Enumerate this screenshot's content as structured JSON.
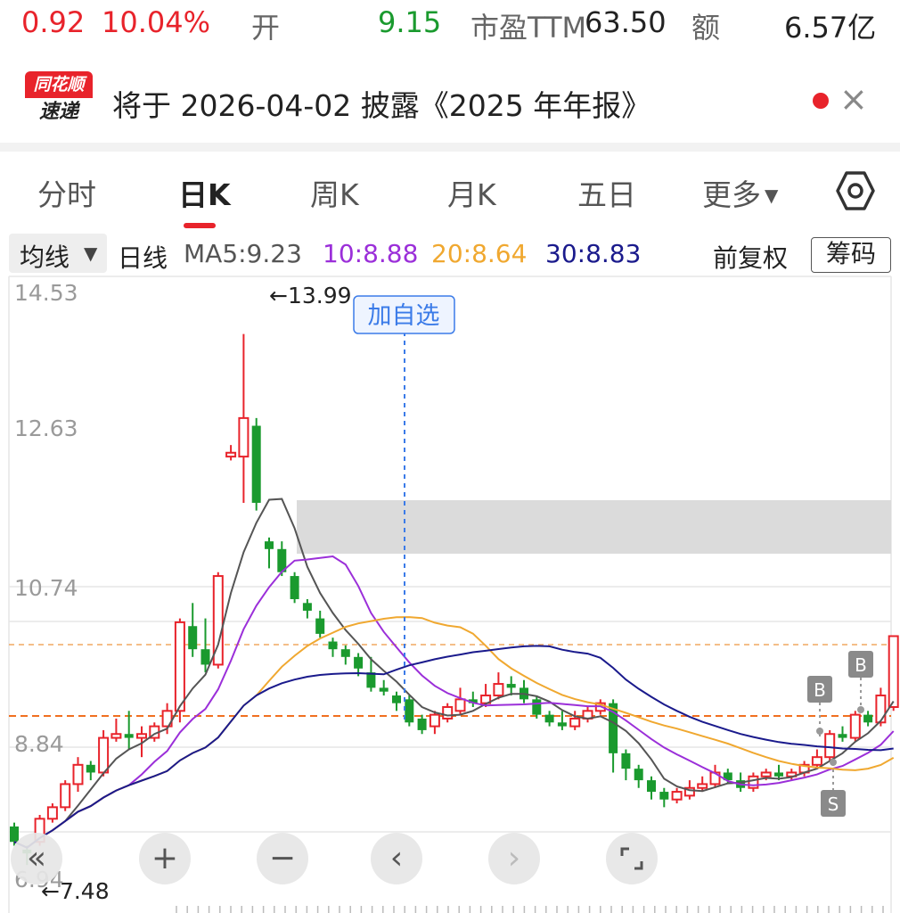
{
  "quote": {
    "change": "0.92",
    "change_pct": "10.04%",
    "open_label": "开",
    "open_value": "9.15",
    "pe_label": "市盈TTM",
    "pe_value": "63.50",
    "amount_label": "额",
    "amount_value": "6.57亿"
  },
  "notice": {
    "logo_top": "同花顺",
    "logo_bottom": "速递",
    "text": "将于 2026-04-02 披露《2025 年年报》"
  },
  "tabs": [
    "分时",
    "日K",
    "周K",
    "月K",
    "五日",
    "更多"
  ],
  "active_tab": "日K",
  "ma": {
    "selector": "均线",
    "period": "日线",
    "ma5": "MA5:9.23",
    "ma10": "10:8.88",
    "ma20": "20:8.64",
    "ma30": "30:8.83",
    "adjust": "前复权",
    "chips": "筹码"
  },
  "colors": {
    "up": "#e8232b",
    "down": "#1a9a2e",
    "ma5": "#555555",
    "ma10": "#9b2fd9",
    "ma20": "#f0a830",
    "ma30": "#1a1a8c",
    "crosshair": "#3b7be8"
  },
  "chart_data": {
    "type": "candlestick",
    "y_ticks": [
      "14.53",
      "12.63",
      "10.74",
      "8.84",
      "6.94"
    ],
    "ylim": [
      6.94,
      14.53
    ],
    "high_marker": "←13.99",
    "low_marker": "←7.48",
    "add_watch_label": "加自选",
    "signals": [
      "B",
      "B",
      "S"
    ],
    "candles": [
      [
        7.6,
        7.4,
        7.65,
        7.35
      ],
      [
        7.3,
        7.25,
        7.35,
        7.1
      ],
      [
        7.4,
        7.7,
        7.75,
        7.35
      ],
      [
        7.7,
        7.85,
        7.9,
        7.65
      ],
      [
        7.85,
        8.15,
        8.2,
        7.8
      ],
      [
        8.15,
        8.4,
        8.5,
        8.05
      ],
      [
        8.4,
        8.3,
        8.45,
        8.2
      ],
      [
        8.3,
        8.75,
        8.85,
        8.25
      ],
      [
        8.75,
        8.8,
        9.0,
        8.7
      ],
      [
        8.8,
        8.75,
        9.1,
        8.6
      ],
      [
        8.75,
        8.8,
        8.9,
        8.5
      ],
      [
        8.75,
        8.9,
        8.95,
        8.7
      ],
      [
        8.9,
        9.1,
        9.2,
        8.8
      ],
      [
        9.1,
        10.25,
        10.3,
        8.95
      ],
      [
        10.2,
        9.9,
        10.5,
        9.8
      ],
      [
        9.9,
        9.7,
        10.3,
        9.6
      ],
      [
        9.7,
        10.85,
        10.9,
        9.65
      ],
      [
        12.4,
        12.45,
        12.55,
        12.35
      ],
      [
        12.4,
        12.9,
        13.99,
        11.8
      ],
      [
        12.8,
        11.8,
        12.9,
        11.7
      ],
      [
        11.3,
        11.2,
        11.35,
        10.95
      ],
      [
        11.2,
        10.9,
        11.3,
        10.85
      ],
      [
        10.85,
        10.55,
        10.9,
        10.5
      ],
      [
        10.5,
        10.4,
        10.55,
        10.3
      ],
      [
        10.3,
        10.1,
        10.4,
        10.05
      ],
      [
        10.0,
        9.9,
        10.05,
        9.8
      ],
      [
        9.9,
        9.8,
        9.95,
        9.7
      ],
      [
        9.8,
        9.65,
        9.85,
        9.55
      ],
      [
        9.6,
        9.4,
        9.8,
        9.35
      ],
      [
        9.4,
        9.35,
        9.5,
        9.3
      ],
      [
        9.3,
        9.2,
        9.35,
        9.1
      ],
      [
        9.25,
        8.95,
        9.3,
        8.9
      ],
      [
        9.0,
        8.85,
        9.05,
        8.8
      ],
      [
        8.9,
        9.05,
        9.1,
        8.8
      ],
      [
        9.0,
        9.15,
        9.2,
        8.95
      ],
      [
        9.1,
        9.25,
        9.4,
        9.05
      ],
      [
        9.25,
        9.2,
        9.35,
        9.15
      ],
      [
        9.2,
        9.3,
        9.45,
        9.15
      ],
      [
        9.3,
        9.45,
        9.6,
        9.25
      ],
      [
        9.45,
        9.4,
        9.55,
        9.3
      ],
      [
        9.4,
        9.25,
        9.5,
        9.2
      ],
      [
        9.25,
        9.05,
        9.3,
        9.0
      ],
      [
        9.05,
        8.95,
        9.1,
        8.9
      ],
      [
        8.95,
        8.9,
        9.1,
        8.85
      ],
      [
        8.9,
        9.0,
        9.1,
        8.85
      ],
      [
        9.0,
        9.1,
        9.15,
        8.95
      ],
      [
        9.1,
        9.2,
        9.25,
        9.05
      ],
      [
        9.2,
        8.55,
        9.25,
        8.3
      ],
      [
        8.55,
        8.35,
        8.6,
        8.2
      ],
      [
        8.35,
        8.2,
        8.4,
        8.1
      ],
      [
        8.2,
        8.05,
        8.25,
        7.95
      ],
      [
        8.05,
        7.95,
        8.1,
        7.85
      ],
      [
        7.95,
        8.05,
        8.1,
        7.9
      ],
      [
        8.0,
        8.1,
        8.2,
        7.95
      ],
      [
        8.1,
        8.15,
        8.25,
        8.05
      ],
      [
        8.15,
        8.3,
        8.4,
        8.1
      ],
      [
        8.3,
        8.2,
        8.35,
        8.15
      ],
      [
        8.2,
        8.1,
        8.3,
        8.05
      ],
      [
        8.1,
        8.25,
        8.3,
        8.05
      ],
      [
        8.25,
        8.3,
        8.35,
        8.2
      ],
      [
        8.3,
        8.25,
        8.4,
        8.2
      ],
      [
        8.25,
        8.3,
        8.35,
        8.2
      ],
      [
        8.3,
        8.4,
        8.45,
        8.25
      ],
      [
        8.4,
        8.5,
        8.6,
        8.35
      ],
      [
        8.5,
        8.8,
        8.85,
        8.45
      ],
      [
        8.8,
        8.75,
        8.9,
        8.7
      ],
      [
        8.75,
        9.05,
        9.1,
        8.7
      ],
      [
        9.05,
        8.95,
        9.1,
        8.9
      ],
      [
        8.95,
        9.3,
        9.4,
        8.9
      ],
      [
        9.15,
        10.07,
        10.07,
        9.1
      ]
    ]
  }
}
